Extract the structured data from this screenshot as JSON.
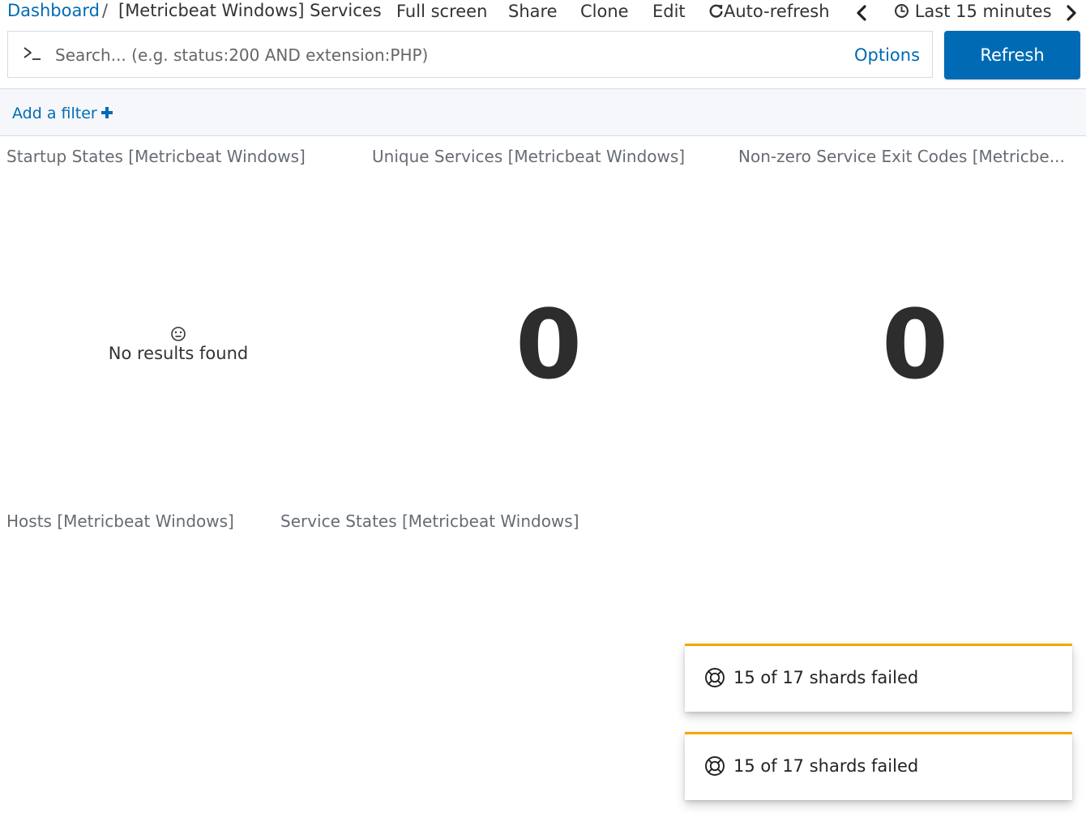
{
  "breadcrumb": {
    "root": "Dashboard",
    "separator": "/",
    "title": "[Metricbeat Windows] Services"
  },
  "top_menu": {
    "full_screen": "Full screen",
    "share": "Share",
    "clone": "Clone",
    "edit": "Edit",
    "auto_refresh": "Auto-refresh",
    "time_range": "Last 15 minutes"
  },
  "search": {
    "placeholder": "Search... (e.g. status:200 AND extension:PHP)",
    "value": "",
    "options_label": "Options",
    "refresh_label": "Refresh"
  },
  "filter_bar": {
    "add_filter_label": "Add a filter"
  },
  "panels": {
    "startup_states": {
      "title": "Startup States [Metricbeat Windows]",
      "empty_message": "No results found"
    },
    "unique_services": {
      "title": "Unique Services [Metricbeat Windows]",
      "value": "0"
    },
    "exit_codes": {
      "title": "Non-zero Service Exit Codes [Metricbe...",
      "value": "0"
    },
    "hosts": {
      "title": "Hosts [Metricbeat Windows]"
    },
    "service_states": {
      "title": "Service States [Metricbeat Windows]"
    }
  },
  "toasts": [
    {
      "message": "15 of 17 shards failed"
    },
    {
      "message": "15 of 17 shards failed"
    }
  ],
  "colors": {
    "link": "#006bb4",
    "primary_button": "#006bb4",
    "toast_warning_border": "#f5a700",
    "filter_bar_bg": "#f5f7fa"
  },
  "icons": {
    "auto_refresh": "refresh-icon",
    "previous": "chevron-left-icon",
    "next": "chevron-right-icon",
    "time": "clock-icon",
    "prompt": "terminal-prompt-icon",
    "add_filter": "plus-icon",
    "no_results": "neutral-face-icon",
    "toast": "lifebuoy-icon"
  }
}
